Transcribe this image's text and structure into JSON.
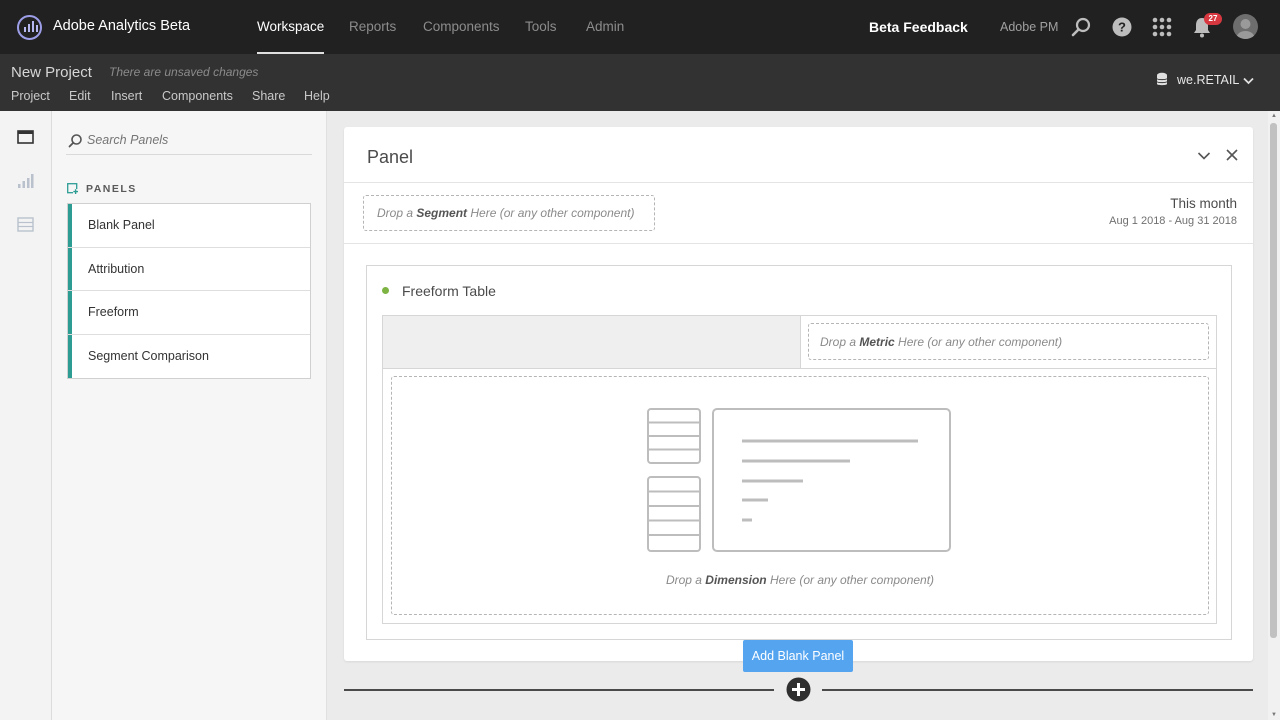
{
  "app": {
    "title": "Adobe Analytics Beta"
  },
  "topnav": {
    "items": [
      "Workspace",
      "Reports",
      "Components",
      "Tools",
      "Admin"
    ],
    "active": "Workspace",
    "feedback": "Beta Feedback",
    "user": "Adobe PM",
    "notification_count": "27",
    "icons": [
      "search-icon",
      "help-icon",
      "app-grid-icon",
      "bell-icon",
      "avatar"
    ]
  },
  "project": {
    "name": "New Project",
    "status": "There are unsaved changes",
    "menus": [
      "Project",
      "Edit",
      "Insert",
      "Components",
      "Share",
      "Help"
    ],
    "report_suite": "we.RETAIL"
  },
  "rail": {
    "icons": [
      "panels-icon",
      "visualizations-icon",
      "components-icon"
    ]
  },
  "sidebar": {
    "search_placeholder": "Search Panels",
    "heading": "PANELS",
    "items": [
      "Blank Panel",
      "Attribution",
      "Freeform",
      "Segment Comparison"
    ]
  },
  "panel": {
    "title": "Panel",
    "segment_drop": {
      "pre": "Drop a ",
      "bold": "Segment",
      "post": " Here (or any other component)"
    },
    "date_label": "This month",
    "date_range": "Aug 1 2018 - Aug 31 2018"
  },
  "freeform": {
    "title": "Freeform Table",
    "metric_drop": {
      "pre": "Drop a ",
      "bold": "Metric",
      "post": " Here (or any other component)"
    },
    "dimension_drop": {
      "pre": "Drop a ",
      "bold": "Dimension",
      "post": " Here (or any other component)"
    }
  },
  "add_panel": {
    "label": "Add Blank Panel"
  },
  "colors": {
    "accent_blue": "#54a4f0",
    "teal": "#2d9d94",
    "green_dot": "#7cb342",
    "topbar": "#212121",
    "projectbar": "#323232"
  }
}
